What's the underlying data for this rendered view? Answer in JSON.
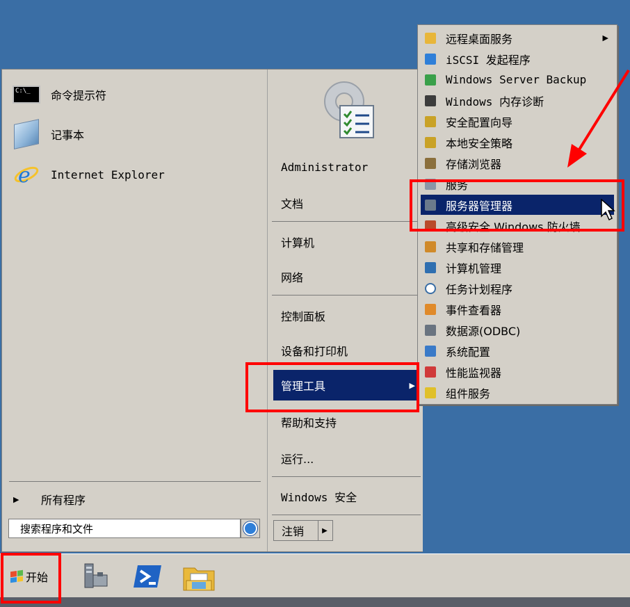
{
  "pinned": [
    {
      "label": "命令提示符",
      "icon": "command-prompt-icon"
    },
    {
      "label": "记事本",
      "icon": "notepad-icon"
    },
    {
      "label": "Internet Explorer",
      "icon": "internet-explorer-icon"
    }
  ],
  "all_programs_label": "所有程序",
  "search_placeholder": "搜索程序和文件",
  "right": {
    "user": "Administrator",
    "documents": "文档",
    "computer": "计算机",
    "network": "网络",
    "control_panel": "控制面板",
    "devices_printers": "设备和打印机",
    "admin_tools": "管理工具",
    "help": "帮助和支持",
    "run": "运行...",
    "security": "Windows 安全",
    "logoff": "注销"
  },
  "submenu": [
    {
      "label": "远程桌面服务",
      "icon": "folder-icon",
      "has_submenu": true
    },
    {
      "label": "iSCSI 发起程序",
      "icon": "iscsi-globe-icon"
    },
    {
      "label": "Windows Server Backup",
      "icon": "backup-icon"
    },
    {
      "label": "Windows 内存诊断",
      "icon": "memory-chip-icon"
    },
    {
      "label": "安全配置向导",
      "icon": "security-wizard-icon"
    },
    {
      "label": "本地安全策略",
      "icon": "security-policy-icon"
    },
    {
      "label": "存储浏览器",
      "icon": "storage-explorer-icon"
    },
    {
      "label": "服务",
      "icon": "services-gear-icon"
    },
    {
      "label": "服务器管理器",
      "icon": "server-manager-icon",
      "selected": true
    },
    {
      "label": "高级安全 Windows 防火墙",
      "icon": "firewall-icon"
    },
    {
      "label": "共享和存储管理",
      "icon": "share-storage-icon"
    },
    {
      "label": "计算机管理",
      "icon": "computer-management-icon"
    },
    {
      "label": "任务计划程序",
      "icon": "clock-icon"
    },
    {
      "label": "事件查看器",
      "icon": "event-viewer-icon"
    },
    {
      "label": "数据源(ODBC)",
      "icon": "odbc-icon"
    },
    {
      "label": "系统配置",
      "icon": "system-config-icon"
    },
    {
      "label": "性能监视器",
      "icon": "performance-monitor-icon"
    },
    {
      "label": "组件服务",
      "icon": "component-services-icon"
    }
  ],
  "taskbar": {
    "start_label": "开始",
    "icons": [
      "server-manager-taskbar-icon",
      "powershell-icon",
      "explorer-folder-icon"
    ]
  },
  "colors": {
    "desktop": "#3a6ea5",
    "menu_bg": "#d4d0c8",
    "highlight": "#0a246a",
    "annotation": "#ff0000"
  }
}
